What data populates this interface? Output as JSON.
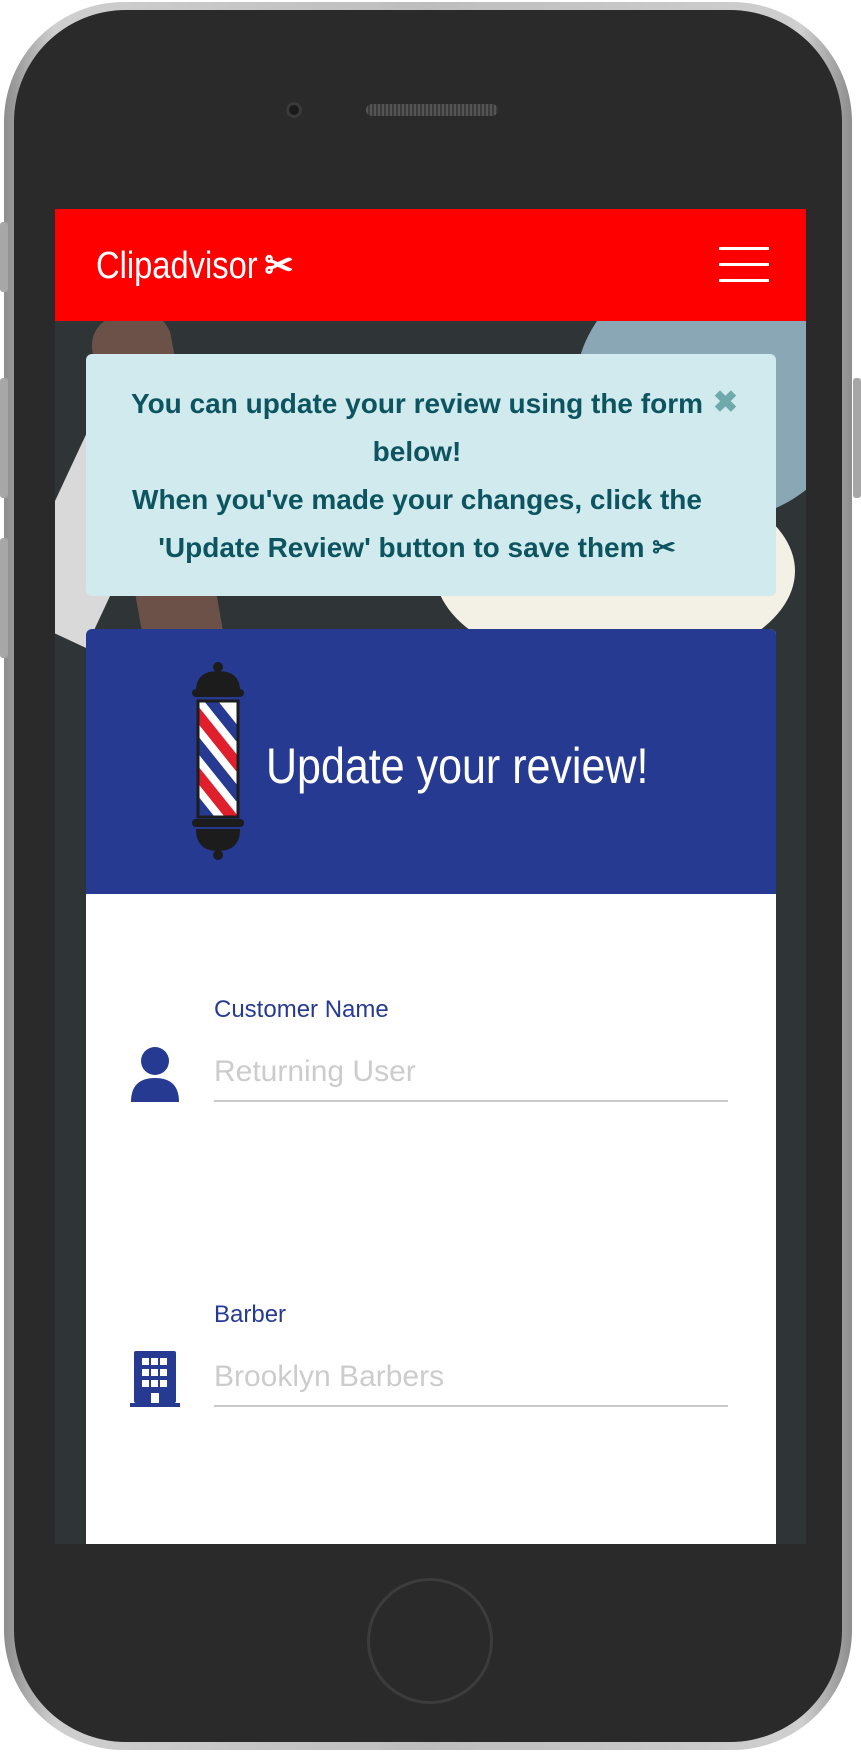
{
  "navbar": {
    "brand": "Clipadvisor",
    "brand_icon": "scissors-icon",
    "menu_icon": "hamburger-menu-icon",
    "color": "#ff0000"
  },
  "alert": {
    "line1": "You can update your review using the form below!",
    "line2": "When you've made your changes, click the 'Update Review' button to save them",
    "close": "✖",
    "trailing_icon": "scissors-icon"
  },
  "card": {
    "title": "Update your review!",
    "header_icon": "barber-pole-icon",
    "header_color": "#263a91"
  },
  "form": {
    "customer_name": {
      "label": "Customer Name",
      "placeholder": "Returning User",
      "icon": "user-icon"
    },
    "barber": {
      "label": "Barber",
      "placeholder": "Brooklyn Barbers",
      "icon": "building-icon"
    }
  }
}
